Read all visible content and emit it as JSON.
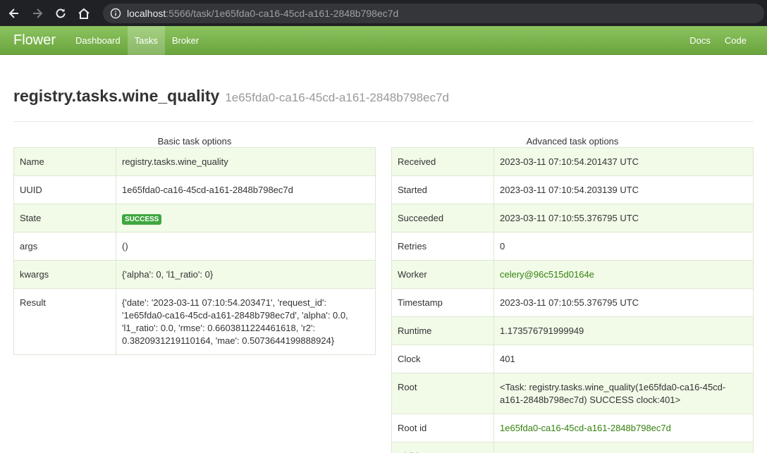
{
  "browser": {
    "url_host": "localhost",
    "url_rest": ":5566/task/1e65fda0-ca16-45cd-a161-2848b798ec7d"
  },
  "navbar": {
    "brand": "Flower",
    "items": [
      {
        "label": "Dashboard"
      },
      {
        "label": "Tasks"
      },
      {
        "label": "Broker"
      }
    ],
    "right_items": [
      {
        "label": "Docs"
      },
      {
        "label": "Code"
      }
    ]
  },
  "header": {
    "task_name": "registry.tasks.wine_quality",
    "task_uuid": "1e65fda0-ca16-45cd-a161-2848b798ec7d"
  },
  "basic": {
    "caption": "Basic task options",
    "rows": [
      {
        "key": "Name",
        "value": "registry.tasks.wine_quality"
      },
      {
        "key": "UUID",
        "value": "1e65fda0-ca16-45cd-a161-2848b798ec7d"
      },
      {
        "key": "State",
        "value": "SUCCESS"
      },
      {
        "key": "args",
        "value": "()"
      },
      {
        "key": "kwargs",
        "value": "{'alpha': 0, 'l1_ratio': 0}"
      },
      {
        "key": "Result",
        "value": "{'date': '2023-03-11 07:10:54.203471', 'request_id': '1e65fda0-ca16-45cd-a161-2848b798ec7d', 'alpha': 0.0, 'l1_ratio': 0.0, 'rmse': 0.6603811224461618, 'r2': 0.3820931219110164, 'mae': 0.5073644199888924}"
      }
    ]
  },
  "advanced": {
    "caption": "Advanced task options",
    "rows": [
      {
        "key": "Received",
        "value": "2023-03-11 07:10:54.201437 UTC"
      },
      {
        "key": "Started",
        "value": "2023-03-11 07:10:54.203139 UTC"
      },
      {
        "key": "Succeeded",
        "value": "2023-03-11 07:10:55.376795 UTC"
      },
      {
        "key": "Retries",
        "value": "0"
      },
      {
        "key": "Worker",
        "value": "celery@96c515d0164e"
      },
      {
        "key": "Timestamp",
        "value": "2023-03-11 07:10:55.376795 UTC"
      },
      {
        "key": "Runtime",
        "value": "1.173576791999949"
      },
      {
        "key": "Clock",
        "value": "401"
      },
      {
        "key": "Root",
        "value": "<Task: registry.tasks.wine_quality(1e65fda0-ca16-45cd-a161-2848b798ec7d) SUCCESS clock:401>"
      },
      {
        "key": "Root id",
        "value": "1e65fda0-ca16-45cd-a161-2848b798ec7d"
      },
      {
        "key": "Children",
        "value": ""
      }
    ]
  },
  "colors": {
    "navbar_green": "#6aa43d",
    "success_badge": "#3fa73f",
    "link_green": "#35820d",
    "row_shade": "#f1fbe8"
  }
}
